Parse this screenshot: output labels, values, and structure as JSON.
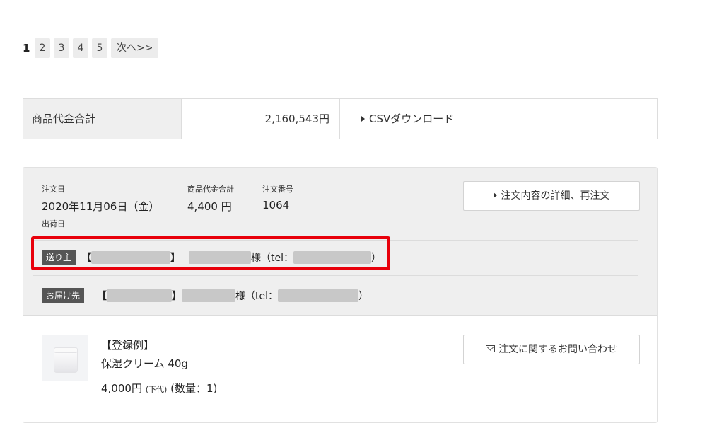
{
  "pagination": {
    "current": "1",
    "pages": [
      "2",
      "3",
      "4",
      "5"
    ],
    "next_label": "次へ>>"
  },
  "summary": {
    "label": "商品代金合計",
    "amount": "2,160,543円",
    "csv_label": "CSVダウンロード"
  },
  "order": {
    "order_date_label": "注文日",
    "order_date": "2020年11月06日（金）",
    "ship_date_label": "出荷日",
    "subtotal_label": "商品代金合計",
    "subtotal": "4,400 円",
    "order_no_label": "注文番号",
    "order_no": "1064",
    "detail_button": "注文内容の詳細、再注文",
    "sender": {
      "badge": "送り主",
      "open_bracket": "【",
      "close_bracket": "】",
      "honorific": "様（tel：",
      "close_paren": "）"
    },
    "recipient": {
      "badge": "お届け先",
      "open_bracket": "【",
      "close_bracket": "】",
      "honorific": "様（tel：",
      "close_paren": "）"
    },
    "item": {
      "name_line1": "【登録例】",
      "name_line2": "保湿クリーム 40g",
      "price": "4,000円",
      "price_note": "(下代)",
      "quantity": "(数量：1)"
    },
    "contact_button": "注文に関するお問い合わせ"
  },
  "colors": {
    "highlight": "#e8000b",
    "badge_bg": "#555555",
    "header_bg": "#efefef"
  }
}
